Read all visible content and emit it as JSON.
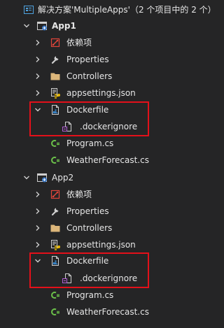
{
  "solution": {
    "label": "解决方案'MultipleApps'（2 个项目中的 2 个）"
  },
  "projects": [
    {
      "name": "App1",
      "items": {
        "deps": "依赖项",
        "properties": "Properties",
        "controllers": "Controllers",
        "appsettings": "appsettings.json",
        "dockerfile": "Dockerfile",
        "dockerignore": ".dockerignore",
        "program": "Program.cs",
        "weather": "WeatherForecast.cs"
      }
    },
    {
      "name": "App2",
      "items": {
        "deps": "依赖项",
        "properties": "Properties",
        "controllers": "Controllers",
        "appsettings": "appsettings.json",
        "dockerfile": "Dockerfile",
        "dockerignore": ".dockerignore",
        "program": "Program.cs",
        "weather": "WeatherForecast.cs"
      }
    }
  ],
  "colors": {
    "highlight": "#e3101a",
    "csharp": "#6cc24a",
    "folder": "#dcb67a"
  }
}
